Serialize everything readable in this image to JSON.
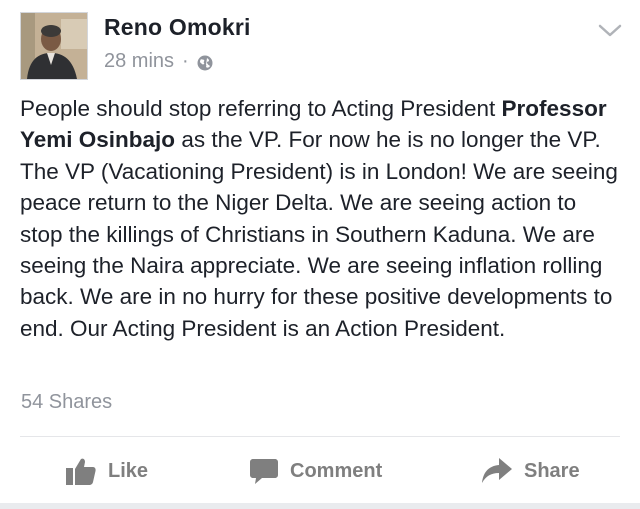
{
  "post": {
    "author_name": "Reno Omokri",
    "time": "28 mins",
    "separator": "·",
    "privacy_icon": "globe-icon",
    "menu_icon": "chevron-down-icon",
    "text_part1": "People should stop referring to Acting President ",
    "text_bold": "Professor Yemi Osinbajo",
    "text_part2": " as the VP. For now he is no longer the VP. The VP (Vacationing President) is in London! We are seeing peace return to the Niger Delta. We are seeing action to stop the killings of Christians in Southern Kaduna. We are seeing the Naira appreciate. We are seeing inflation rolling back. We are in no hurry for these positive developments to end. Our Acting President is an Action President.",
    "shares": "54 Shares"
  },
  "actions": {
    "like_label": "Like",
    "comment_label": "Comment",
    "share_label": "Share"
  },
  "colors": {
    "text": "#1d2129",
    "meta": "#90949c",
    "action": "#7f7f7f",
    "divider": "#e5e6e9"
  }
}
